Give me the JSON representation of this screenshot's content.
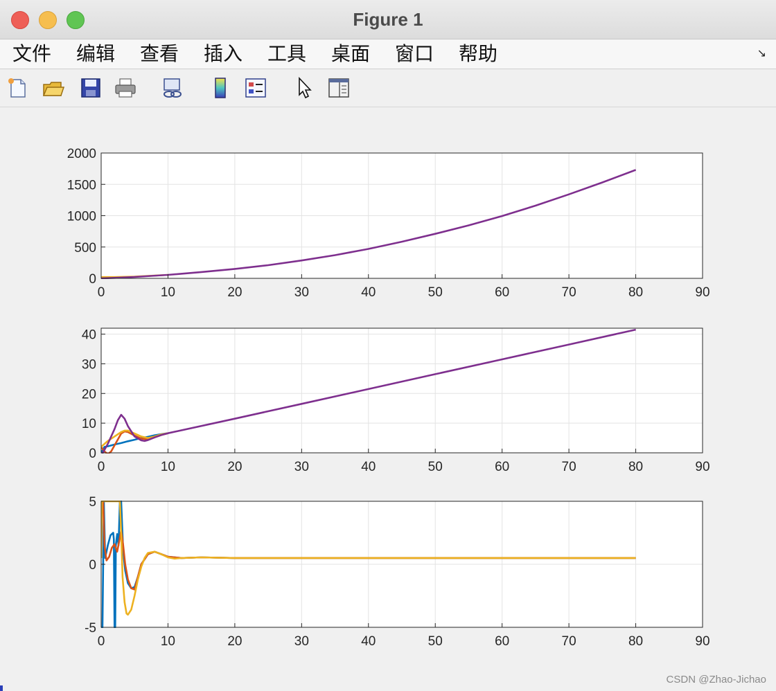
{
  "window": {
    "title": "Figure 1"
  },
  "menu": {
    "items": [
      "文件",
      "编辑",
      "查看",
      "插入",
      "工具",
      "桌面",
      "窗口",
      "帮助"
    ]
  },
  "toolbar": {
    "icons": [
      "new-figure-icon",
      "open-file-icon",
      "save-icon",
      "print-icon",
      "link-icon",
      "colorbar-icon",
      "legend-icon",
      "pointer-icon",
      "property-panel-icon"
    ]
  },
  "colors": {
    "blue": "#0072bd",
    "orange": "#d95319",
    "yellow": "#edb120",
    "purple": "#7e2f8e"
  },
  "watermark": "CSDN @Zhao-Jichao",
  "chart_data": [
    {
      "type": "line",
      "xlim": [
        0,
        90
      ],
      "ylim": [
        0,
        2000
      ],
      "xticks": [
        0,
        10,
        20,
        30,
        40,
        50,
        60,
        70,
        80,
        90
      ],
      "yticks": [
        0,
        500,
        1000,
        1500,
        2000
      ],
      "grid": true,
      "series": [
        {
          "color": "#edb120",
          "x": [
            0,
            1,
            2,
            5,
            10
          ],
          "y": [
            20,
            20,
            20,
            27,
            55
          ]
        },
        {
          "color": "#7e2f8e",
          "x": [
            0,
            2,
            5,
            10,
            15,
            20,
            25,
            30,
            35,
            40,
            45,
            50,
            55,
            60,
            65,
            70,
            75,
            80
          ],
          "y": [
            0,
            8,
            22,
            55,
            100,
            150,
            210,
            285,
            370,
            470,
            585,
            710,
            845,
            995,
            1160,
            1340,
            1530,
            1730
          ]
        }
      ]
    },
    {
      "type": "line",
      "xlim": [
        0,
        90
      ],
      "ylim": [
        0,
        42
      ],
      "xticks": [
        0,
        10,
        20,
        30,
        40,
        50,
        60,
        70,
        80,
        90
      ],
      "yticks": [
        0,
        10,
        20,
        30,
        40
      ],
      "grid": true,
      "series": [
        {
          "color": "#0072bd",
          "x": [
            0,
            0.5,
            1,
            2,
            3,
            4,
            5,
            6,
            7,
            8,
            9,
            10
          ],
          "y": [
            0,
            2,
            2.2,
            2.8,
            3.3,
            3.9,
            4.4,
            5.0,
            5.4,
            5.9,
            6.3,
            6.6
          ]
        },
        {
          "color": "#d95319",
          "x": [
            0,
            0.5,
            1,
            1.5,
            2,
            2.5,
            3,
            3.5,
            4,
            5,
            6,
            7,
            8,
            9,
            10
          ],
          "y": [
            2,
            0.5,
            -0.5,
            0.5,
            2.5,
            4.5,
            6.5,
            7.2,
            7.0,
            5.8,
            4.8,
            4.5,
            5.2,
            6.0,
            6.6
          ]
        },
        {
          "color": "#edb120",
          "x": [
            0,
            0.5,
            1,
            2,
            3,
            3.5,
            4,
            5,
            6,
            7,
            8,
            9,
            10
          ],
          "y": [
            2,
            3,
            4,
            5.5,
            7,
            7.5,
            7.5,
            6.5,
            5.5,
            5.0,
            5.5,
            6.2,
            6.6
          ]
        },
        {
          "color": "#7e2f8e",
          "x": [
            0,
            1,
            2,
            2.5,
            3,
            3.5,
            4,
            5,
            6,
            6.5,
            7,
            8,
            9,
            10,
            20,
            30,
            40,
            50,
            60,
            70,
            80
          ],
          "y": [
            -1,
            3,
            8,
            11,
            12.8,
            11.5,
            9,
            5.5,
            4.2,
            4.0,
            4.3,
            5.2,
            6.0,
            6.6,
            11.5,
            16.5,
            21.5,
            26.5,
            31.5,
            36.5,
            41.5
          ]
        }
      ]
    },
    {
      "type": "line",
      "xlim": [
        0,
        90
      ],
      "ylim": [
        -5,
        5
      ],
      "xticks": [
        0,
        10,
        20,
        30,
        40,
        50,
        60,
        70,
        80,
        90
      ],
      "yticks": [
        -5,
        0,
        5
      ],
      "grid": true,
      "series": [
        {
          "color": "#0072bd",
          "x": [
            0,
            0.2,
            0.4,
            0.6,
            1.0,
            1.4,
            1.8,
            1.9,
            2.0,
            2.1,
            2.2,
            2.4,
            2.6,
            2.8,
            3.0,
            3.3,
            3.6,
            4.0,
            4.5,
            5.0,
            5.5,
            6.0,
            7.0,
            8.0,
            9.0,
            10.0,
            12.0,
            15.0,
            20.0,
            80.0
          ],
          "y": [
            -5,
            -5,
            5,
            0.5,
            1.5,
            2.3,
            2.5,
            2.0,
            -5,
            -5,
            1.5,
            2.4,
            1.5,
            5,
            5,
            1.0,
            -0.5,
            -1.5,
            -1.9,
            -1.8,
            -1.0,
            0,
            0.8,
            1.0,
            0.8,
            0.6,
            0.5,
            0.55,
            0.5,
            0.5
          ]
        },
        {
          "color": "#d95319",
          "x": [
            0,
            0.1,
            0.3,
            0.5,
            0.8,
            1.2,
            1.6,
            2.0,
            2.4,
            2.7,
            3.0,
            3.3,
            3.6,
            4.0,
            4.5,
            5.0,
            5.5,
            6.0,
            7.0,
            8.0,
            9.0,
            10.0,
            12.0,
            15.0,
            20.0,
            80.0
          ],
          "y": [
            0.5,
            5,
            5,
            1.5,
            0.3,
            0.6,
            1.3,
            1.6,
            1.0,
            1.8,
            2.7,
            1.5,
            0.0,
            -1.2,
            -1.9,
            -2.0,
            -1.0,
            0,
            0.8,
            1.0,
            0.8,
            0.6,
            0.5,
            0.55,
            0.5,
            0.5
          ]
        },
        {
          "color": "#edb120",
          "x": [
            0,
            0.1,
            0.3,
            2.2,
            2.5,
            2.8,
            3.0,
            3.2,
            3.5,
            3.8,
            4.0,
            4.5,
            5.0,
            5.5,
            6.0,
            6.5,
            7.0,
            8.0,
            9.0,
            10.0,
            11.0,
            12.0,
            15.0,
            20.0,
            80.0
          ],
          "y": [
            0.5,
            5,
            5,
            5,
            5,
            5,
            2.5,
            -1.0,
            -3.0,
            -3.9,
            -4.0,
            -3.6,
            -2.5,
            -1.2,
            -0.2,
            0.5,
            0.9,
            1.0,
            0.8,
            0.55,
            0.45,
            0.5,
            0.55,
            0.5,
            0.5
          ]
        }
      ]
    }
  ]
}
